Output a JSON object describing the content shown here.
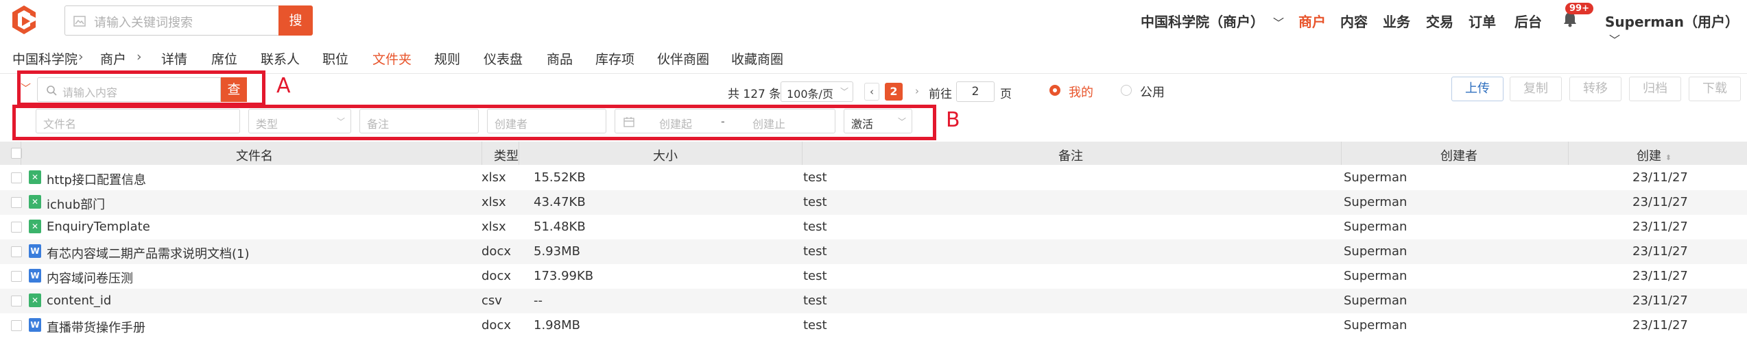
{
  "header": {
    "search_placeholder": "请输入关键词搜索",
    "search_button": "搜",
    "org_name": "中国科学院（商户）",
    "nav": [
      "商户",
      "内容",
      "业务",
      "交易",
      "订单",
      "后台"
    ],
    "badge": "99+",
    "user": "Superman（用户）"
  },
  "subnav": {
    "breadcrumb": [
      "中国科学院",
      "商户"
    ],
    "tabs": [
      "详情",
      "席位",
      "联系人",
      "职位",
      "文件夹",
      "规则",
      "仪表盘",
      "商品",
      "库存项",
      "伙伴商圈",
      "收藏商圈"
    ],
    "active_tab": "文件夹"
  },
  "toolbar": {
    "keyword_placeholder": "请输入内容",
    "query_button": "查",
    "marker_a": "A",
    "marker_b": "B",
    "total_prefix": "共",
    "total": "127",
    "total_suffix": "条",
    "page_size": "100条/页",
    "current_page": "2",
    "goto_prefix": "前往",
    "goto_value": "2",
    "goto_suffix": "页",
    "radio_mine": "我的",
    "radio_public": "公用",
    "buttons": [
      "上传",
      "复制",
      "转移",
      "归档",
      "下载"
    ]
  },
  "filters": {
    "file_name": "文件名",
    "type": "类型",
    "remark": "备注",
    "creator": "创建者",
    "created_from": "创建起",
    "range_sep": "-",
    "created_to": "创建止",
    "status": "激活"
  },
  "table": {
    "headers": [
      "文件名",
      "类型",
      "大小",
      "备注",
      "创建者",
      "创建"
    ],
    "rows": [
      {
        "icon": "excel-icon",
        "name": "http接口配置信息",
        "type": "xlsx",
        "size": "15.52KB",
        "remark": "test",
        "creator": "Superman",
        "created": "23/11/27"
      },
      {
        "icon": "excel-icon",
        "name": "ichub部门",
        "type": "xlsx",
        "size": "43.47KB",
        "remark": "test",
        "creator": "Superman",
        "created": "23/11/27"
      },
      {
        "icon": "excel-icon",
        "name": "EnquiryTemplate",
        "type": "xlsx",
        "size": "51.48KB",
        "remark": "test",
        "creator": "Superman",
        "created": "23/11/27"
      },
      {
        "icon": "word-icon",
        "name": "有芯内容域二期产品需求说明文档(1)",
        "type": "docx",
        "size": "5.93MB",
        "remark": "test",
        "creator": "Superman",
        "created": "23/11/27"
      },
      {
        "icon": "word-icon",
        "name": "内容域问卷压测",
        "type": "docx",
        "size": "173.99KB",
        "remark": "test",
        "creator": "Superman",
        "created": "23/11/27"
      },
      {
        "icon": "excel-icon",
        "name": "content_id",
        "type": "csv",
        "size": "--",
        "remark": "test",
        "creator": "Superman",
        "created": "23/11/27"
      },
      {
        "icon": "word-icon",
        "name": "直播带货操作手册",
        "type": "docx",
        "size": "1.98MB",
        "remark": "test",
        "creator": "Superman",
        "created": "23/11/27"
      }
    ]
  },
  "colors": {
    "accent": "#e8552c",
    "annotation": "#e3182d",
    "link": "#2f6fbf"
  }
}
